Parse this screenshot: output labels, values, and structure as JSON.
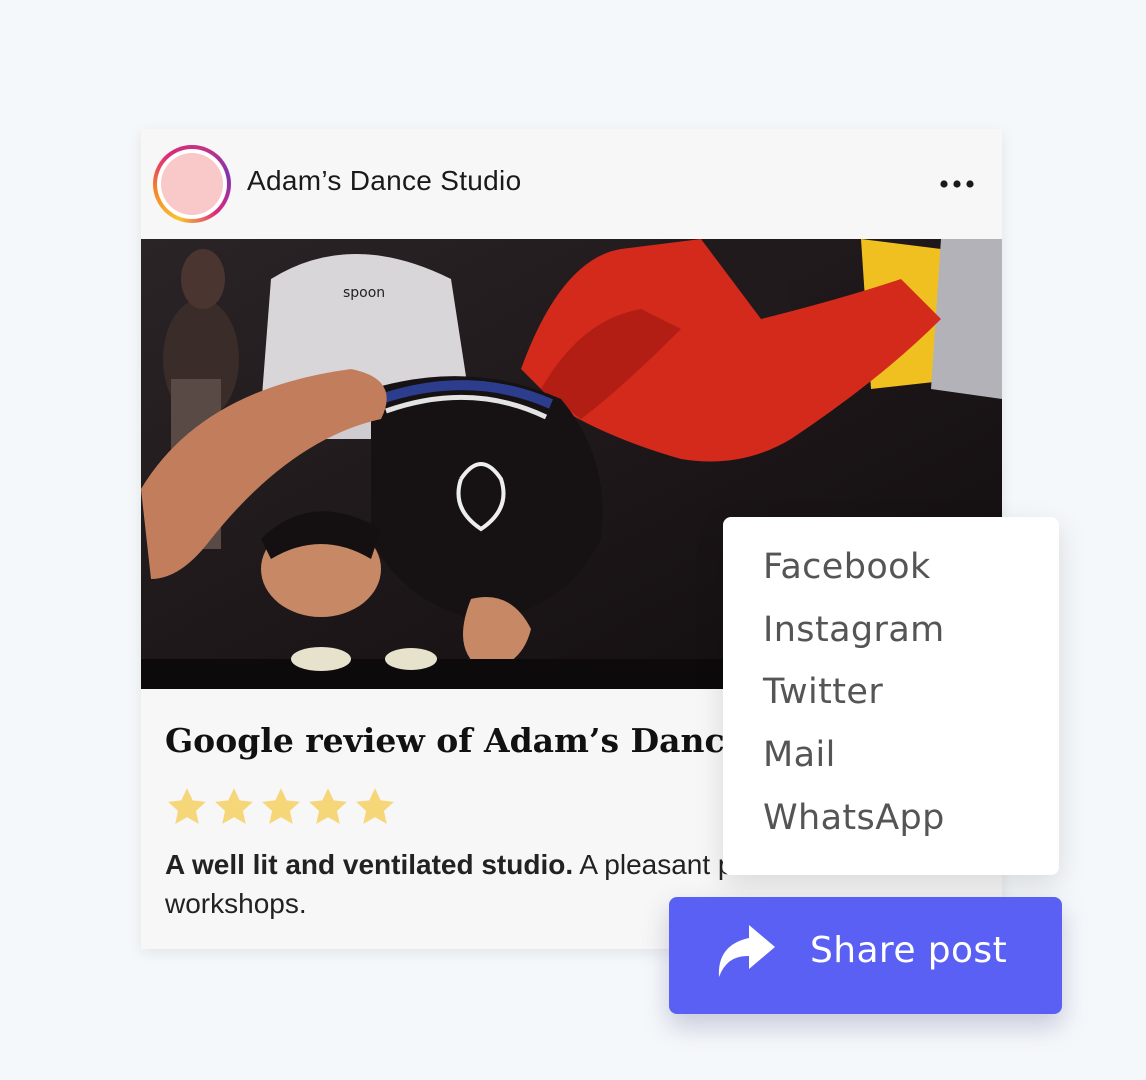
{
  "post": {
    "author": "Adam’s Dance Studio",
    "avatar_icon": "avatar-icon",
    "more_icon": "more-horizontal-icon",
    "photo_icon": "breakdance-photo"
  },
  "review": {
    "title": "Google review of Adam’s Dance Studio",
    "rating": 5,
    "rating_max": 5,
    "star_color": "#f5d77a",
    "text_bold": "A well lit and ventilated studio.",
    "text_rest": " A pleasant place to attend workshops."
  },
  "share_menu": {
    "items": [
      "Facebook",
      "Instagram",
      "Twitter",
      "Mail",
      "WhatsApp"
    ]
  },
  "share_button": {
    "label": "Share post",
    "icon": "share-arrow-icon",
    "color": "#5b60f5"
  }
}
